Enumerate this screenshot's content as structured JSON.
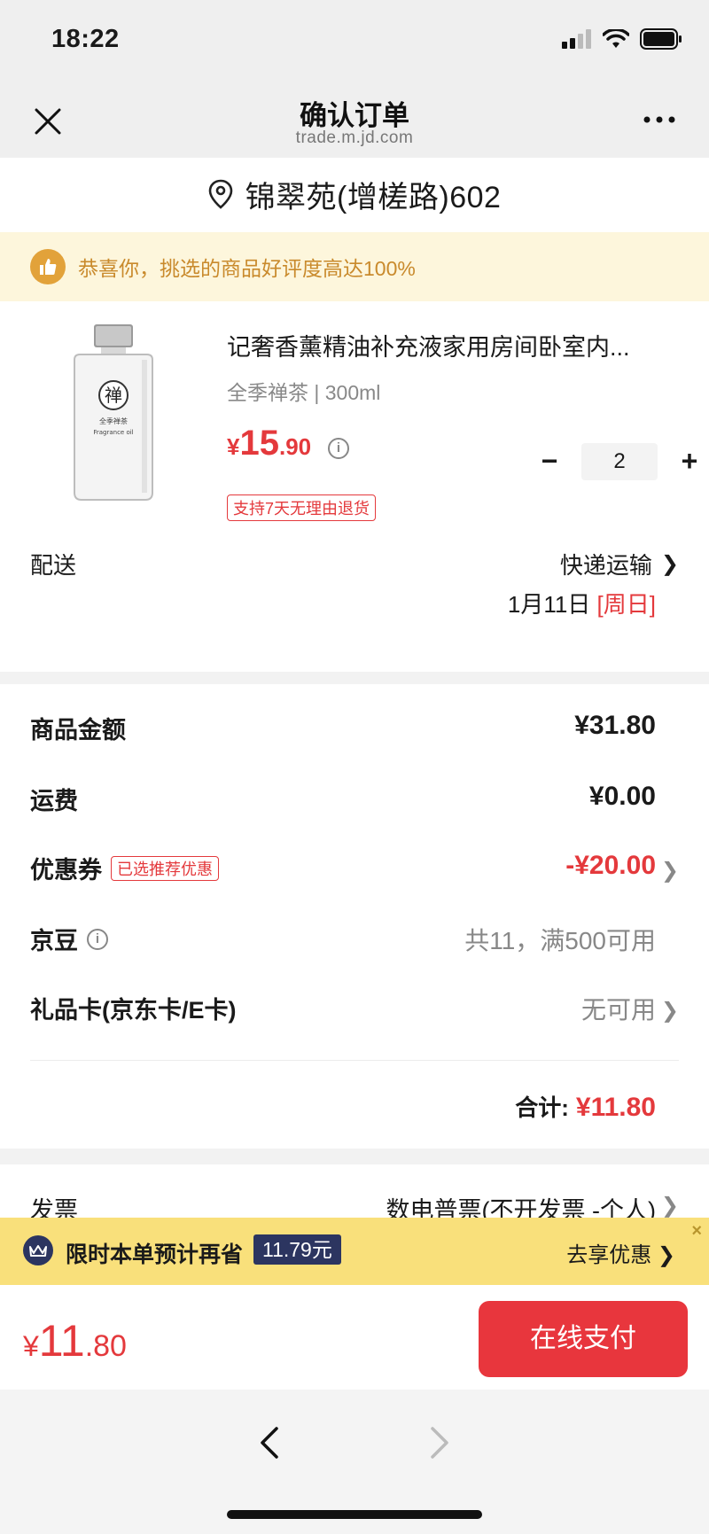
{
  "status_bar": {
    "time": "18:22"
  },
  "nav": {
    "title": "确认订单",
    "url": "trade.m.jd.com"
  },
  "address": {
    "text": "锦翠苑(增槎路)602"
  },
  "notice": {
    "text": "恭喜你，挑选的商品好评度高达100%"
  },
  "product": {
    "title": "记奢香薰精油补充液家用房间卧室内...",
    "spec": "全季禅茶 | 300ml",
    "price_currency": "¥",
    "price_int": "15",
    "price_dec": ".90",
    "return_tag": "支持7天无理由退货",
    "quantity": "2",
    "image_label_top": "禅",
    "image_label_brand": "全季禅茶",
    "image_label_sub": "Fragrance oil"
  },
  "delivery": {
    "label": "配送",
    "method": "快递运输",
    "date": "1月11日",
    "day": "[周日]"
  },
  "summary": {
    "goods_label": "商品金额",
    "goods_value": "¥31.80",
    "shipping_label": "运费",
    "shipping_value": "¥0.00",
    "coupon_label": "优惠券",
    "coupon_tag": "已选推荐优惠",
    "coupon_value": "-¥20.00",
    "beans_label": "京豆",
    "beans_value": "共11，满500可用",
    "giftcard_label": "礼品卡(京东卡/E卡)",
    "giftcard_value": "无可用",
    "total_label": "合计:",
    "total_value": "¥11.80"
  },
  "invoice": {
    "label": "发票",
    "value": "数电普票(不开发票 -个人)"
  },
  "promo": {
    "text": "限时本单预计再省",
    "amount": "11.79元",
    "link": "去享优惠 ❯",
    "close": "×"
  },
  "bottom": {
    "price_currency": "¥",
    "price_int": "11",
    "price_dec": ".80",
    "pay_label": "在线支付"
  },
  "colors": {
    "accent_red": "#e4393c",
    "pay_button": "#e8363d",
    "notice_text": "#c98a2c",
    "promo_bg": "#f9e07b",
    "promo_dark": "#2c3560"
  },
  "icons": [
    "close-icon",
    "more-icon",
    "location-pin-icon",
    "thumbs-up-icon",
    "info-icon",
    "chevron-right-icon",
    "crown-icon",
    "back-arrow-icon",
    "forward-arrow-icon",
    "signal-icon",
    "wifi-icon",
    "battery-icon"
  ]
}
